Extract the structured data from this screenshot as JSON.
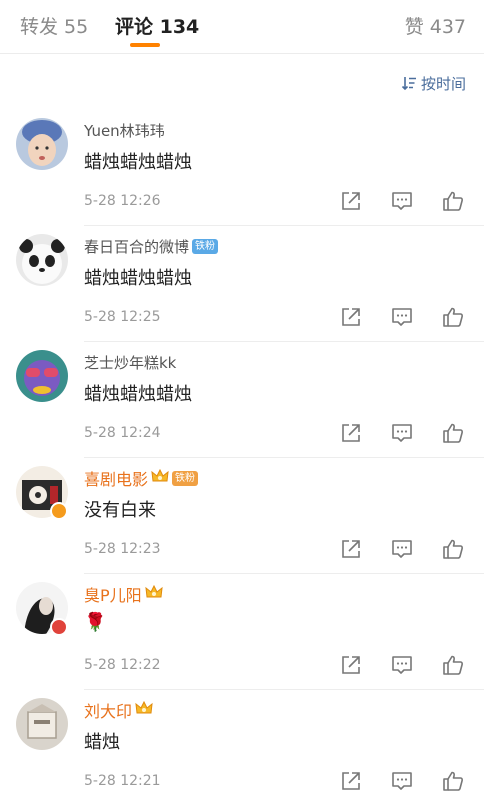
{
  "tabs": {
    "repost": "转发 55",
    "comment": "评论 134",
    "like": "赞 437"
  },
  "sort": {
    "label": "按时间"
  },
  "comments": [
    {
      "name": "Yuen林玮玮",
      "text": "蜡烛蜡烛蜡烛",
      "time": "5-28 12:26"
    },
    {
      "name": "春日百合的微博",
      "badge": "铁粉",
      "text": "蜡烛蜡烛蜡烛",
      "time": "5-28 12:25"
    },
    {
      "name": "芝士炒年糕kk",
      "text": "蜡烛蜡烛蜡烛",
      "time": "5-28 12:24"
    },
    {
      "name": "喜剧电影",
      "badge": "铁粉",
      "text": "没有白来",
      "time": "5-28 12:23"
    },
    {
      "name": "臭P儿阳",
      "text": "🌹",
      "time": "5-28 12:22"
    },
    {
      "name": "刘大印",
      "text": "蜡烛",
      "time": "5-28 12:21"
    }
  ],
  "colors": {
    "accent": "#ff8200",
    "link": "#4a6d9c",
    "member_name": "#e8721c",
    "fan_badge": "#5aa9e6"
  }
}
